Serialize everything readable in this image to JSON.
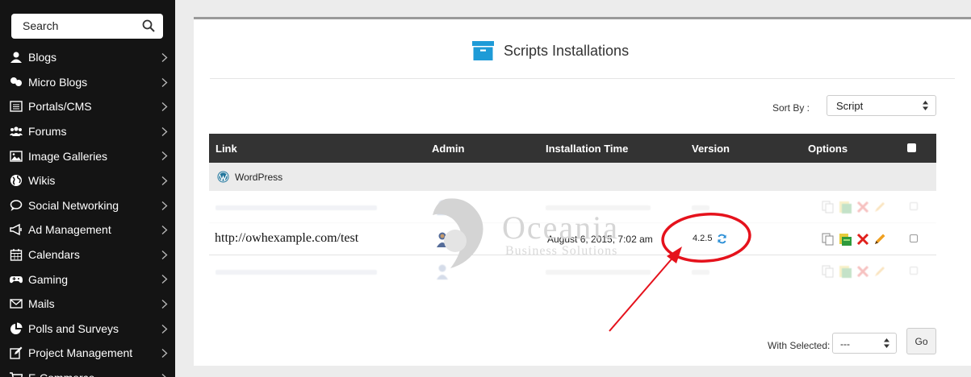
{
  "sidebar": {
    "search": {
      "placeholder": "Search"
    },
    "items": [
      {
        "label": "Blogs",
        "icon": "user-icon"
      },
      {
        "label": "Micro Blogs",
        "icon": "users-chat-icon"
      },
      {
        "label": "Portals/CMS",
        "icon": "list-box-icon"
      },
      {
        "label": "Forums",
        "icon": "group-icon"
      },
      {
        "label": "Image Galleries",
        "icon": "image-icon"
      },
      {
        "label": "Wikis",
        "icon": "globe-icon"
      },
      {
        "label": "Social Networking",
        "icon": "chat-bubble-icon"
      },
      {
        "label": "Ad Management",
        "icon": "megaphone-icon"
      },
      {
        "label": "Calendars",
        "icon": "calendar-icon"
      },
      {
        "label": "Gaming",
        "icon": "gamepad-icon"
      },
      {
        "label": "Mails",
        "icon": "envelope-icon"
      },
      {
        "label": "Polls and Surveys",
        "icon": "pie-chart-icon"
      },
      {
        "label": "Project Management",
        "icon": "edit-icon"
      },
      {
        "label": "E-Commerce",
        "icon": "cart-icon"
      }
    ]
  },
  "main": {
    "title": "Scripts Installations",
    "title_icon": "archive-box-icon",
    "sort": {
      "label": "Sort By :",
      "value": "Script"
    },
    "table": {
      "columns": [
        "Link",
        "Admin",
        "Installation Time",
        "Version",
        "Options"
      ],
      "group": "WordPress",
      "rows": [
        {
          "link": "",
          "time": "",
          "version": "",
          "faded": true
        },
        {
          "link": "http://owhexample.com/test",
          "time": "August 6, 2015, 7:02 am",
          "version": "4.2.5",
          "faded": false
        },
        {
          "link": "",
          "time": "",
          "version": "",
          "faded": true
        }
      ]
    },
    "bulk": {
      "label": "With Selected:",
      "value": "---",
      "go_label": "Go"
    }
  },
  "watermark": {
    "name": "Oceania",
    "subtitle": "Business Solutions"
  },
  "colors": {
    "sidebar_bg": "#141414",
    "header_bg": "#333333",
    "accent_blue": "#1e9bd7",
    "annotation_red": "#e5121c"
  }
}
